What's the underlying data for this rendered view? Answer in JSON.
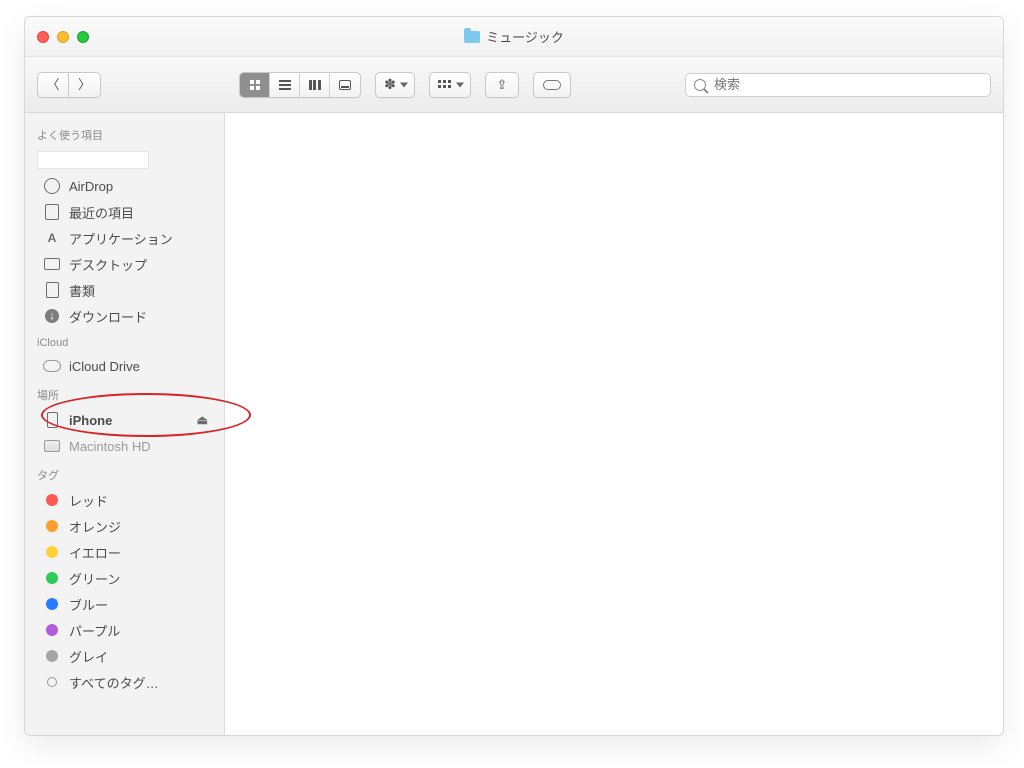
{
  "window": {
    "title": "ミュージック"
  },
  "toolbar": {
    "search_placeholder": "検索"
  },
  "sidebar": {
    "favorites": {
      "heading": "よく使う項目",
      "items": [
        {
          "label": "AirDrop"
        },
        {
          "label": "最近の項目"
        },
        {
          "label": "アプリケーション"
        },
        {
          "label": "デスクトップ"
        },
        {
          "label": "書類"
        },
        {
          "label": "ダウンロード"
        }
      ]
    },
    "icloud": {
      "heading": "iCloud",
      "items": [
        {
          "label": "iCloud Drive"
        }
      ]
    },
    "locations": {
      "heading": "場所",
      "items": [
        {
          "label": "iPhone",
          "ejectable": true,
          "bold": true
        },
        {
          "label": "Macintosh HD"
        }
      ]
    },
    "tags": {
      "heading": "タグ",
      "items": [
        {
          "label": "レッド",
          "color": "red"
        },
        {
          "label": "オレンジ",
          "color": "orange"
        },
        {
          "label": "イエロー",
          "color": "yellow"
        },
        {
          "label": "グリーン",
          "color": "green"
        },
        {
          "label": "ブルー",
          "color": "blue"
        },
        {
          "label": "パープル",
          "color": "purple"
        },
        {
          "label": "グレイ",
          "color": "gray"
        },
        {
          "label": "すべてのタグ…",
          "color": "hollow"
        }
      ]
    }
  }
}
